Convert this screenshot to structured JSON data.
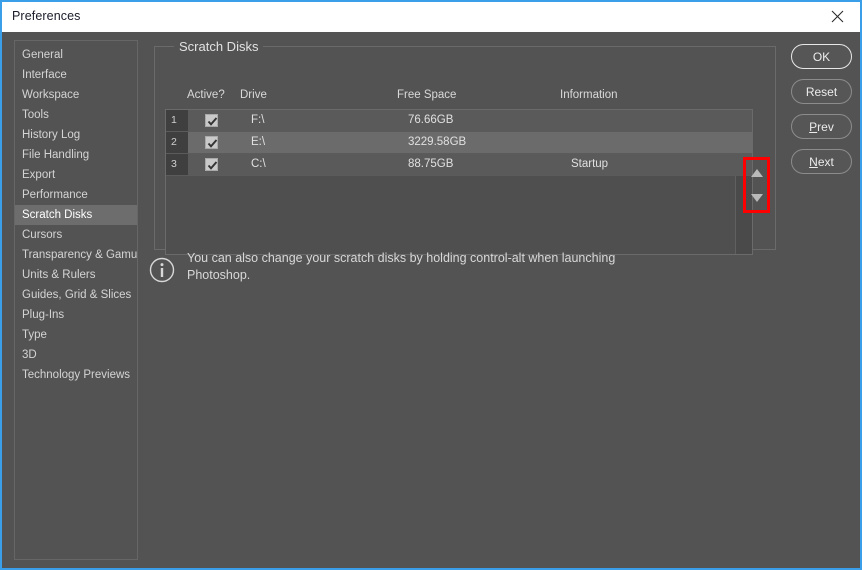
{
  "window": {
    "title": "Preferences",
    "close_icon": "close-icon",
    "border_color": "#3a9fe8"
  },
  "sidebar": {
    "items": [
      {
        "label": "General",
        "selected": false
      },
      {
        "label": "Interface",
        "selected": false
      },
      {
        "label": "Workspace",
        "selected": false
      },
      {
        "label": "Tools",
        "selected": false
      },
      {
        "label": "History Log",
        "selected": false
      },
      {
        "label": "File Handling",
        "selected": false
      },
      {
        "label": "Export",
        "selected": false
      },
      {
        "label": "Performance",
        "selected": false
      },
      {
        "label": "Scratch Disks",
        "selected": true
      },
      {
        "label": "Cursors",
        "selected": false
      },
      {
        "label": "Transparency & Gamut",
        "selected": false
      },
      {
        "label": "Units & Rulers",
        "selected": false
      },
      {
        "label": "Guides, Grid & Slices",
        "selected": false
      },
      {
        "label": "Plug-Ins",
        "selected": false
      },
      {
        "label": "Type",
        "selected": false
      },
      {
        "label": "3D",
        "selected": false
      },
      {
        "label": "Technology Previews",
        "selected": false
      }
    ]
  },
  "main": {
    "group_title": "Scratch Disks",
    "columns": [
      "Active?",
      "Drive",
      "Free Space",
      "Information"
    ],
    "rows": [
      {
        "num": "1",
        "active": true,
        "drive": "F:\\",
        "free_space": "76.66GB",
        "information": "",
        "selected": false
      },
      {
        "num": "2",
        "active": true,
        "drive": "E:\\",
        "free_space": "3229.58GB",
        "information": "",
        "selected": true
      },
      {
        "num": "3",
        "active": true,
        "drive": "C:\\",
        "free_space": "88.75GB",
        "information": "Startup",
        "selected": false
      }
    ],
    "sort_controls": {
      "up_icon": "triangle-up-icon",
      "down_icon": "triangle-down-icon",
      "highlight_color": "#ff0000"
    },
    "note": {
      "icon": "info-icon",
      "text": "You can also change your scratch disks by holding control-alt when launching Photoshop."
    }
  },
  "buttons": {
    "ok": "OK",
    "reset": "Reset",
    "prev_prefix": "P",
    "prev_rest": "rev",
    "next_prefix": "N",
    "next_rest": "ext"
  }
}
